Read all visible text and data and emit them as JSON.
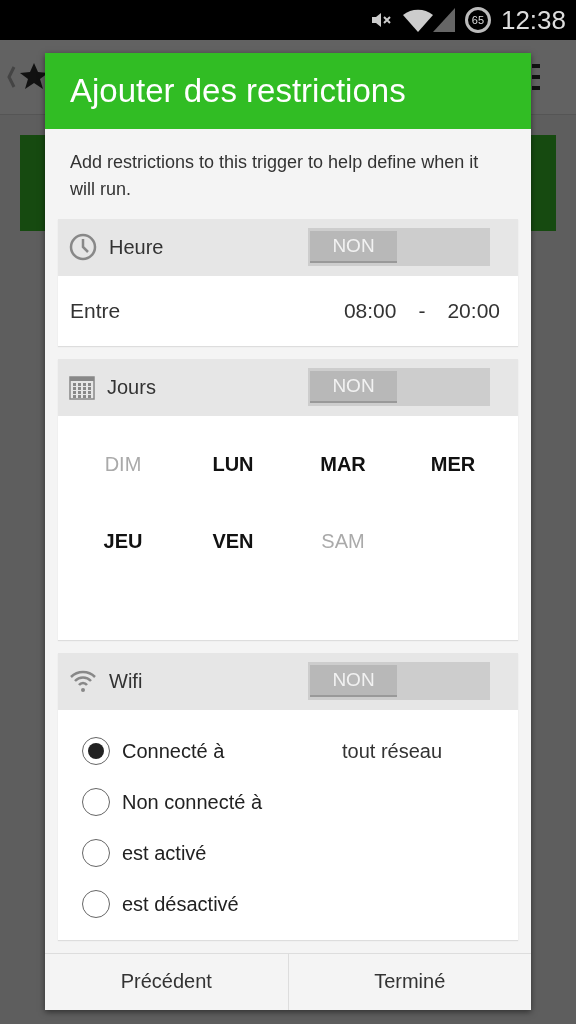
{
  "status_bar": {
    "battery": "65",
    "time": "12:38"
  },
  "dialog": {
    "title": "Ajouter des restrictions",
    "intro": "Add restrictions to this trigger to help define when it will run.",
    "sections": [
      {
        "kind": "time",
        "label": "Heure",
        "toggle": {
          "label": "NON",
          "on": false
        },
        "row_label": "Entre",
        "from": "08:00",
        "separator": "-",
        "to": "20:00"
      },
      {
        "kind": "days",
        "label": "Jours",
        "toggle": {
          "label": "NON",
          "on": false
        },
        "days": [
          {
            "label": "DIM",
            "selected": false
          },
          {
            "label": "LUN",
            "selected": true
          },
          {
            "label": "MAR",
            "selected": true
          },
          {
            "label": "MER",
            "selected": true
          },
          {
            "label": "JEU",
            "selected": true
          },
          {
            "label": "VEN",
            "selected": true
          },
          {
            "label": "SAM",
            "selected": false
          }
        ]
      },
      {
        "kind": "wifi",
        "label": "Wifi",
        "toggle": {
          "label": "NON",
          "on": false
        },
        "network": "tout réseau",
        "options": [
          {
            "label": "Connecté à",
            "selected": true
          },
          {
            "label": "Non connecté à",
            "selected": false
          },
          {
            "label": "est activé",
            "selected": false
          },
          {
            "label": "est désactivé",
            "selected": false
          }
        ]
      }
    ],
    "buttons": [
      "Précédent",
      "Terminé"
    ]
  }
}
